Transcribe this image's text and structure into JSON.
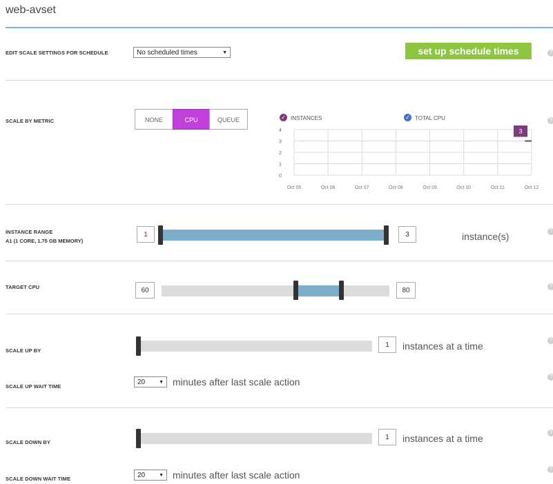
{
  "header": {
    "title": "web-avset"
  },
  "schedule": {
    "label": "EDIT SCALE SETTINGS FOR SCHEDULE",
    "select_value": "No scheduled times",
    "button_label": "set up schedule times"
  },
  "metric": {
    "label": "SCALE BY METRIC",
    "options": [
      "NONE",
      "CPU",
      "QUEUE"
    ],
    "selected": "CPU"
  },
  "chart_data": {
    "type": "line",
    "legend": [
      "INSTANCES",
      "TOTAL CPU"
    ],
    "legend_colors": [
      "#7b3d7b",
      "#4a6fc9"
    ],
    "categories": [
      "Oct 05",
      "Oct 06",
      "Oct 07",
      "Oct 08",
      "Oct 09",
      "Oct 10",
      "Oct 11",
      "Oct 12"
    ],
    "yticks": [
      "4",
      "3",
      "2",
      "1",
      "0"
    ],
    "ylim": [
      0,
      4
    ],
    "series": [
      {
        "name": "INSTANCES",
        "x": [
          11.8,
          12
        ],
        "values": [
          3,
          3
        ]
      }
    ],
    "badge": "3"
  },
  "instance_range": {
    "label": "INSTANCE RANGE",
    "sublabel": "A1 (1 CORE, 1.75 GB MEMORY)",
    "min": "1",
    "max": "3",
    "unit": "instance(s)"
  },
  "target_cpu": {
    "label": "TARGET CPU",
    "min": "60",
    "max": "80"
  },
  "scale_up": {
    "label": "SCALE UP BY",
    "value": "1",
    "suffix": "instances at a time",
    "wait_label": "SCALE UP WAIT TIME",
    "wait_value": "20",
    "wait_suffix": "minutes after last scale action"
  },
  "scale_down": {
    "label": "SCALE DOWN BY",
    "value": "1",
    "suffix": "instances at a time",
    "wait_label": "SCALE DOWN WAIT TIME",
    "wait_value": "20",
    "wait_suffix": "minutes after last scale action"
  },
  "colors": {
    "accent_green": "#8dc63f",
    "selected_purple": "#c140d9",
    "range_fill": "#7aaecb"
  }
}
